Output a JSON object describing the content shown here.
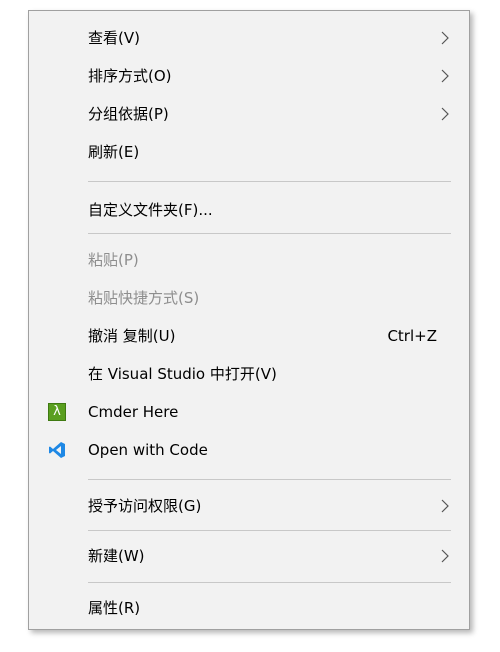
{
  "menu": {
    "view": {
      "label": "查看(V)"
    },
    "sort_by": {
      "label": "排序方式(O)"
    },
    "group_by": {
      "label": "分组依据(P)"
    },
    "refresh": {
      "label": "刷新(E)"
    },
    "customize_folder": {
      "label": "自定义文件夹(F)..."
    },
    "paste": {
      "label": "粘贴(P)"
    },
    "paste_shortcut": {
      "label": "粘贴快捷方式(S)"
    },
    "undo_copy": {
      "label": "撤消 复制(U)",
      "shortcut": "Ctrl+Z"
    },
    "open_in_vs": {
      "label": "在 Visual Studio 中打开(V)"
    },
    "cmder_here": {
      "label": "Cmder Here",
      "icon": "lambda-icon",
      "icon_glyph": "λ"
    },
    "open_with_code": {
      "label": "Open with Code",
      "icon": "vscode-icon"
    },
    "give_access": {
      "label": "授予访问权限(G)"
    },
    "new": {
      "label": "新建(W)"
    },
    "properties": {
      "label": "属性(R)"
    }
  },
  "colors": {
    "menu_background": "#f2f2f2",
    "border": "#a0a0a0",
    "separator": "#c8c8c8",
    "disabled_text": "#8e8e8e",
    "cmder_green": "#5a9f1f",
    "vscode_blue": "#1e88e5"
  }
}
